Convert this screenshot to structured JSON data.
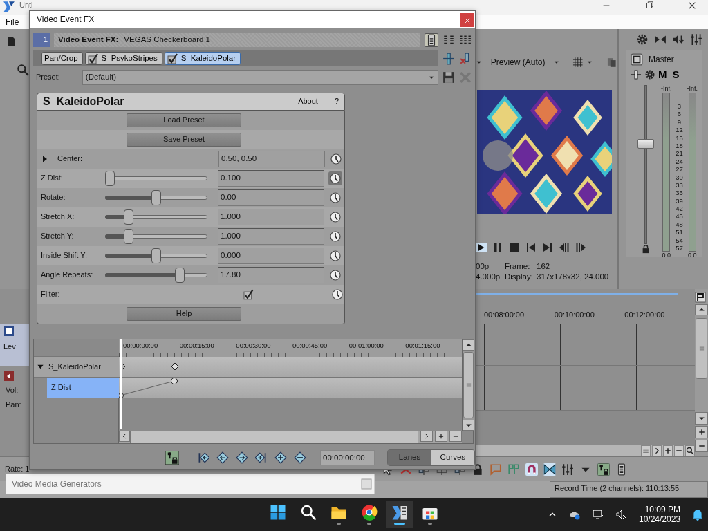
{
  "app": {
    "title": "Unti",
    "menu": [
      "File"
    ],
    "track_header": {
      "label": "Lev",
      "vol_label": "Vol:",
      "pan_label": "Pan:"
    },
    "rate_label": "Rate: 1",
    "preview": {
      "mode": "Preview (Auto)",
      "project_partial": "00p",
      "frame_label": "Frame:",
      "frame": "162",
      "preview_partial": "4.000p",
      "display_label": "Display:",
      "display": "317x178x32, 24.000"
    },
    "master": {
      "label": "Master",
      "mute": "M",
      "solo": "S",
      "peaks": [
        "-Inf.",
        "-Inf."
      ],
      "scale": [
        "3",
        "6",
        "9",
        "12",
        "15",
        "18",
        "21",
        "24",
        "27",
        "30",
        "33",
        "36",
        "39",
        "42",
        "45",
        "48",
        "51",
        "54",
        "57"
      ],
      "readings": [
        "0.0",
        "0.0"
      ],
      "level": 0.64
    },
    "timeline": {
      "ruler": [
        "00:08:00:00",
        "00:10:00:00",
        "00:12:00:00"
      ]
    },
    "status": "Record Time (2 channels): 110:13:55"
  },
  "media_generators": {
    "title": "Video Media Generators"
  },
  "dialog": {
    "title": "Video Event FX",
    "chain_number": "1",
    "header_label": "Video Event FX:",
    "header_value": "VEGAS Checkerboard 1",
    "plugins": [
      {
        "label": "Pan/Crop",
        "selected": false
      },
      {
        "label": "S_PsykoStripes",
        "checked": true,
        "selected": false
      },
      {
        "label": "S_KaleidoPolar",
        "checked": true,
        "selected": true
      }
    ],
    "preset_label": "Preset:",
    "preset": "(Default)",
    "plugin": {
      "name": "S_KaleidoPolar",
      "about": "About",
      "help_mark": "?",
      "buttons": [
        "Load Preset",
        "Save Preset"
      ],
      "params": [
        {
          "kind": "point",
          "label": "Center:",
          "value": "0.50, 0.50",
          "expanded": false,
          "keyframed": false
        },
        {
          "kind": "slider",
          "label": "Z Dist:",
          "value": "0.100",
          "level": 0.0,
          "keyframed": true
        },
        {
          "kind": "slider",
          "label": "Rotate:",
          "value": "0.00",
          "level": 0.5,
          "keyframed": false
        },
        {
          "kind": "slider",
          "label": "Stretch X:",
          "value": "1.000",
          "level": 0.2,
          "keyframed": false
        },
        {
          "kind": "slider",
          "label": "Stretch Y:",
          "value": "1.000",
          "level": 0.2,
          "keyframed": false
        },
        {
          "kind": "slider",
          "label": "Inside Shift Y:",
          "value": "0.000",
          "level": 0.5,
          "keyframed": false
        },
        {
          "kind": "slider",
          "label": "Angle Repeats:",
          "value": "17.80",
          "level": 0.75,
          "keyframed": false
        },
        {
          "kind": "checkbox",
          "label": "Filter:",
          "checked": true,
          "keyframed": false
        }
      ],
      "help": "Help"
    },
    "keyframes": {
      "ruler": [
        "00:00:00:00",
        "00:00:15:00",
        "00:00:30:00",
        "00:00:45:00",
        "00:01:00:00",
        "00:01:15:00"
      ],
      "tracks": [
        {
          "label": "S_KaleidoPolar",
          "expanded": true,
          "selected": false,
          "children": [
            {
              "label": "Z Dist",
              "selected": true
            }
          ]
        }
      ],
      "time": "00:00:00:00",
      "modes": [
        {
          "label": "Lanes",
          "selected": true
        },
        {
          "label": "Curves",
          "selected": false
        }
      ]
    }
  },
  "taskbar": {
    "apps": [
      {
        "kind": "start",
        "running": false,
        "selected": false
      },
      {
        "kind": "search",
        "running": false,
        "selected": false
      },
      {
        "kind": "folder",
        "running": true,
        "selected": false
      },
      {
        "kind": "browser",
        "running": true,
        "selected": false
      },
      {
        "kind": "editor",
        "running": true,
        "selected": true
      },
      {
        "kind": "store",
        "running": true,
        "selected": false
      }
    ],
    "time": "10:09 PM",
    "date": "10/24/2023"
  }
}
